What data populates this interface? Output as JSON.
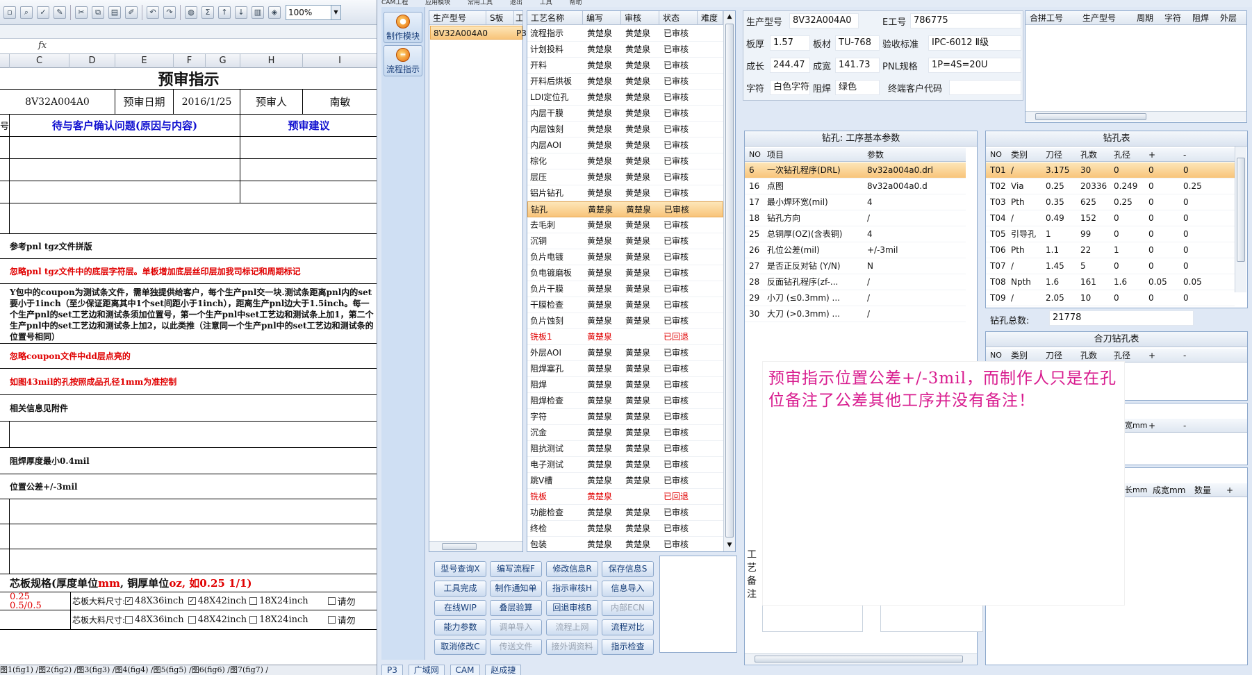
{
  "excel": {
    "zoom": "100%",
    "fx_label": "fx",
    "columns": [
      "C",
      "D",
      "E",
      "F",
      "G",
      "H",
      "I"
    ],
    "title": "预审指示",
    "model_no": "8V32A004A0",
    "review_date_label": "预审日期",
    "review_date": "2016/1/25",
    "reviewer_label": "预审人",
    "reviewer": "南敏",
    "row_prefix": "号",
    "col_question_header": "待与客户确认问题(原因与内容)",
    "col_suggest_header": "预审建议",
    "notes": [
      {
        "text": "参考pnl tgz文件拼版",
        "color": "black"
      },
      {
        "text": "忽略pnl tgz文件中的底层字符层。单板增加底层丝印层加我司标记和周期标记",
        "color": "red"
      },
      {
        "text": "Y包中的coupon为测试条文件，需单独提供给客户，每个生产pnl交一块.测试条距离pnl内的set要小于1inch（至少保证距离其中1个set间距小于1inch），距离生产pnl边大于1.5inch。每一个生产pnl的set工艺边和测试条须加位置号，第一个生产pnl中set工艺边和测试条上加1，第二个生产pnl中的set工艺边和测试条上加2，以此类推（注意同一个生产pnl中的set工艺边和测试条的位置号相同）",
        "color": "black"
      },
      {
        "text": "忽略coupon文件中dd层点亮的",
        "color": "red"
      },
      {
        "text": "如图43mil的孔按照成品孔径1mm为准控制",
        "color": "red"
      },
      {
        "text": "相关信息见附件",
        "color": "black"
      },
      {
        "text": "阻焊厚度最小0.4mil",
        "color": "black"
      },
      {
        "text": "位置公差+/-3mil",
        "color": "black"
      }
    ],
    "core_spec_label": "芯板规格(厚度单位",
    "core_spec_unit_mm": "mm",
    "core_spec_mid": ", 铜厚单位",
    "core_spec_unit_oz": "oz",
    "core_spec_example": ", 如0.25 1/1)",
    "core_values": [
      "0.25",
      "0.5/0.5"
    ],
    "material_size_label": "芯板大料尺寸:",
    "sizes": [
      "48X36inch",
      "48X42inch",
      "18X24inch"
    ],
    "please_check": "请勿",
    "sheet_tabs": "图1(fig1) /图2(fig2) /图3(fig3) /图4(fig4) /图5(fig5) /图6(fig6) /图7(fig7) /"
  },
  "app": {
    "menubar": [
      "CAM工程",
      "应用模块",
      "常用工具",
      "退出",
      "工具",
      "帮助"
    ],
    "nav": [
      {
        "label": "制作模块",
        "icon": "flame-icon"
      },
      {
        "label": "流程指示",
        "icon": "flow-icon"
      }
    ],
    "model_list": {
      "headers": [
        "生产型号",
        "S板",
        "工"
      ],
      "row": "8V32A004A0",
      "row_suffix": "P3"
    },
    "process_headers": [
      "工艺名称",
      "编写",
      "审核",
      "状态",
      "难度"
    ],
    "processes": [
      {
        "name": "流程指示",
        "writer": "黄楚泉",
        "reviewer": "黄楚泉",
        "status": "已审核"
      },
      {
        "name": "计划投料",
        "writer": "黄楚泉",
        "reviewer": "黄楚泉",
        "status": "已审核"
      },
      {
        "name": "开料",
        "writer": "黄楚泉",
        "reviewer": "黄楚泉",
        "status": "已审核"
      },
      {
        "name": "开料后烘板",
        "writer": "黄楚泉",
        "reviewer": "黄楚泉",
        "status": "已审核"
      },
      {
        "name": "LDI定位孔",
        "writer": "黄楚泉",
        "reviewer": "黄楚泉",
        "status": "已审核"
      },
      {
        "name": "内层干膜",
        "writer": "黄楚泉",
        "reviewer": "黄楚泉",
        "status": "已审核"
      },
      {
        "name": "内层蚀刻",
        "writer": "黄楚泉",
        "reviewer": "黄楚泉",
        "status": "已审核"
      },
      {
        "name": "内层AOI",
        "writer": "黄楚泉",
        "reviewer": "黄楚泉",
        "status": "已审核"
      },
      {
        "name": "棕化",
        "writer": "黄楚泉",
        "reviewer": "黄楚泉",
        "status": "已审核"
      },
      {
        "name": "层压",
        "writer": "黄楚泉",
        "reviewer": "黄楚泉",
        "status": "已审核"
      },
      {
        "name": "铝片钻孔",
        "writer": "黄楚泉",
        "reviewer": "黄楚泉",
        "status": "已审核"
      },
      {
        "name": "钻孔",
        "writer": "黄楚泉",
        "reviewer": "黄楚泉",
        "status": "已审核",
        "selected": true
      },
      {
        "name": "去毛刺",
        "writer": "黄楚泉",
        "reviewer": "黄楚泉",
        "status": "已审核"
      },
      {
        "name": "沉铜",
        "writer": "黄楚泉",
        "reviewer": "黄楚泉",
        "status": "已审核"
      },
      {
        "name": "负片电镀",
        "writer": "黄楚泉",
        "reviewer": "黄楚泉",
        "status": "已审核"
      },
      {
        "name": "负电镀磨板",
        "writer": "黄楚泉",
        "reviewer": "黄楚泉",
        "status": "已审核"
      },
      {
        "name": "负片干膜",
        "writer": "黄楚泉",
        "reviewer": "黄楚泉",
        "status": "已审核"
      },
      {
        "name": "干膜检查",
        "writer": "黄楚泉",
        "reviewer": "黄楚泉",
        "status": "已审核"
      },
      {
        "name": "负片蚀刻",
        "writer": "黄楚泉",
        "reviewer": "黄楚泉",
        "status": "已审核"
      },
      {
        "name": "铣板1",
        "writer": "黄楚泉",
        "reviewer": "",
        "status": "已回退",
        "returned": true
      },
      {
        "name": "外层AOI",
        "writer": "黄楚泉",
        "reviewer": "黄楚泉",
        "status": "已审核"
      },
      {
        "name": "阻焊塞孔",
        "writer": "黄楚泉",
        "reviewer": "黄楚泉",
        "status": "已审核"
      },
      {
        "name": "阻焊",
        "writer": "黄楚泉",
        "reviewer": "黄楚泉",
        "status": "已审核"
      },
      {
        "name": "阻焊检查",
        "writer": "黄楚泉",
        "reviewer": "黄楚泉",
        "status": "已审核"
      },
      {
        "name": "字符",
        "writer": "黄楚泉",
        "reviewer": "黄楚泉",
        "status": "已审核"
      },
      {
        "name": "沉金",
        "writer": "黄楚泉",
        "reviewer": "黄楚泉",
        "status": "已审核"
      },
      {
        "name": "阻抗测试",
        "writer": "黄楚泉",
        "reviewer": "黄楚泉",
        "status": "已审核"
      },
      {
        "name": "电子测试",
        "writer": "黄楚泉",
        "reviewer": "黄楚泉",
        "status": "已审核"
      },
      {
        "name": "跳V槽",
        "writer": "黄楚泉",
        "reviewer": "黄楚泉",
        "status": "已审核"
      },
      {
        "name": "铣板",
        "writer": "黄楚泉",
        "reviewer": "",
        "status": "已回退",
        "returned": true
      },
      {
        "name": "功能检查",
        "writer": "黄楚泉",
        "reviewer": "黄楚泉",
        "status": "已审核"
      },
      {
        "name": "终检",
        "writer": "黄楚泉",
        "reviewer": "黄楚泉",
        "status": "已审核"
      },
      {
        "name": "包装",
        "writer": "黄楚泉",
        "reviewer": "黄楚泉",
        "status": "已审核"
      }
    ],
    "buttons": [
      [
        "型号查询X",
        "编写流程F",
        "修改信息R",
        "保存信息S"
      ],
      [
        "工具完成",
        "制作通知单",
        "指示审核H",
        "信息导入"
      ],
      [
        "在线WIP",
        "叠层验算",
        "回退审核B",
        "内部ECN"
      ],
      [
        "能力参数",
        "调单导入",
        "流程上网",
        "流程对比"
      ],
      [
        "取消修改C",
        "传送文件",
        "接外调资料",
        "指示检查"
      ]
    ],
    "info": {
      "model_label": "生产型号",
      "model": "8V32A004A0",
      "eno_label": "E工号",
      "eno": "786775",
      "thick_label": "板厚",
      "thick": "1.57",
      "mat_label": "板材",
      "mat": "TU-768",
      "std_label": "验收标准",
      "std": "IPC-6012 Ⅱ级",
      "len_label": "成长",
      "len": "244.47",
      "wid_label": "成宽",
      "wid": "141.73",
      "pnl_label": "PNL规格",
      "pnl": "1P=4S=20U",
      "char_label": "字符",
      "char": "白色字符",
      "mask_label": "阻焊",
      "mask": "绿色",
      "customer_label": "终端客户代码",
      "customer": ""
    },
    "merge_headers": [
      "合拼工号",
      "生产型号",
      "周期",
      "字符",
      "阻焊",
      "外层"
    ],
    "params": {
      "title": "钻孔: 工序基本参数",
      "headers": [
        "NO",
        "项目",
        "参数"
      ],
      "rows": [
        {
          "no": "6",
          "item": "一次钻孔程序(DRL)",
          "val": "8v32a004a0.drl",
          "selected": true
        },
        {
          "no": "16",
          "item": "点图",
          "val": "8v32a004a0.d"
        },
        {
          "no": "17",
          "item": "最小焊环宽(mil)",
          "val": "4"
        },
        {
          "no": "18",
          "item": "钻孔方向",
          "val": "/"
        },
        {
          "no": "25",
          "item": "总铜厚(OZ)(含表铜)",
          "val": "4"
        },
        {
          "no": "26",
          "item": "孔位公差(mil)",
          "val": "+/-3mil"
        },
        {
          "no": "27",
          "item": "是否正反对钻 (Y/N)",
          "val": "N"
        },
        {
          "no": "28",
          "item": "反面钻孔程序(zf-...",
          "val": "/"
        },
        {
          "no": "29",
          "item": "小刀 (≤0.3mm) ...",
          "val": "/"
        },
        {
          "no": "30",
          "item": "大刀 (>0.3mm) ...",
          "val": "/"
        }
      ]
    },
    "drill": {
      "title": "钻孔表",
      "headers": [
        "NO",
        "类别",
        "刀径",
        "孔数",
        "孔径",
        "+",
        "-"
      ],
      "rows": [
        {
          "no": "T01",
          "type": "/",
          "dia": "3.175",
          "cnt": "30",
          "hole": "0",
          "p": "0",
          "m": "0",
          "selected": true
        },
        {
          "no": "T02",
          "type": "Via",
          "dia": "0.25",
          "cnt": "20336",
          "hole": "0.249",
          "p": "0",
          "m": "0.25"
        },
        {
          "no": "T03",
          "type": "Pth",
          "dia": "0.35",
          "cnt": "625",
          "hole": "0.25",
          "p": "0",
          "m": "0"
        },
        {
          "no": "T04",
          "type": "/",
          "dia": "0.49",
          "cnt": "152",
          "hole": "0",
          "p": "0",
          "m": "0"
        },
        {
          "no": "T05",
          "type": "引导孔",
          "dia": "1",
          "cnt": "99",
          "hole": "0",
          "p": "0",
          "m": "0"
        },
        {
          "no": "T06",
          "type": "Pth",
          "dia": "1.1",
          "cnt": "22",
          "hole": "1",
          "p": "0",
          "m": "0"
        },
        {
          "no": "T07",
          "type": "/",
          "dia": "1.45",
          "cnt": "5",
          "hole": "0",
          "p": "0",
          "m": "0"
        },
        {
          "no": "T08",
          "type": "Npth",
          "dia": "1.6",
          "cnt": "161",
          "hole": "1.6",
          "p": "0.05",
          "m": "0.05"
        },
        {
          "no": "T09",
          "type": "/",
          "dia": "2.05",
          "cnt": "10",
          "hole": "0",
          "p": "0",
          "m": "0"
        }
      ],
      "total_label": "钻孔总数:",
      "total": "21778"
    },
    "combo": {
      "title": "合刀钻孔表",
      "headers": [
        "NO",
        "类别",
        "刀径",
        "孔数",
        "孔径",
        "+",
        "-"
      ]
    },
    "partial_1": [
      "宽mm",
      "+",
      "-"
    ],
    "partial_2": [
      "长mm",
      "成宽mm",
      "数量",
      "+"
    ],
    "gongyi": "工艺备注",
    "bottom_tabs": [
      "P3",
      "广域网",
      "CAM",
      "赵成捷"
    ]
  },
  "annotation": "预审指示位置公差+/-3mil，而制作人只是在孔位备注了公差其他工序并没有备注！"
}
